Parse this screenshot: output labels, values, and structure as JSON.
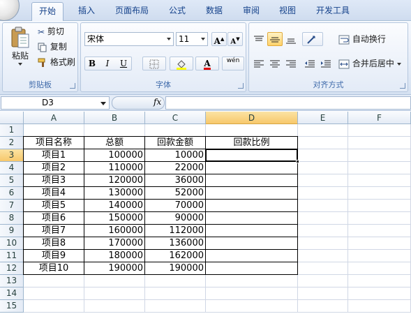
{
  "tabs": [
    "开始",
    "插入",
    "页面布局",
    "公式",
    "数据",
    "审阅",
    "视图",
    "开发工具"
  ],
  "clipboard": {
    "paste": "粘贴",
    "cut": "剪切",
    "copy": "复制",
    "format_painter": "格式刷",
    "label": "剪贴板"
  },
  "font": {
    "name": "宋体",
    "size": "11",
    "label": "字体",
    "bold": "B",
    "italic": "I",
    "underline": "U",
    "grow": "A",
    "shrink": "A",
    "font_color": "A",
    "phonetic": "wén"
  },
  "alignment": {
    "wrap": "自动换行",
    "merge": "合并后居中",
    "label": "对齐方式"
  },
  "formula_bar": {
    "name_box": "D3",
    "fx": "fx",
    "value": ""
  },
  "columns": [
    "A",
    "B",
    "C",
    "D",
    "E",
    "F"
  ],
  "rows": [
    "1",
    "2",
    "3",
    "4",
    "5",
    "6",
    "7",
    "8",
    "9",
    "10",
    "11",
    "12",
    "13",
    "14",
    "15"
  ],
  "table": {
    "headers": [
      "项目名称",
      "总额",
      "回款金额",
      "回款比例"
    ],
    "rows": [
      [
        "项目1",
        "100000",
        "10000",
        ""
      ],
      [
        "项目2",
        "110000",
        "22000",
        ""
      ],
      [
        "项目3",
        "120000",
        "36000",
        ""
      ],
      [
        "项目4",
        "130000",
        "52000",
        ""
      ],
      [
        "项目5",
        "140000",
        "70000",
        ""
      ],
      [
        "项目6",
        "150000",
        "90000",
        ""
      ],
      [
        "项目7",
        "160000",
        "112000",
        ""
      ],
      [
        "项目8",
        "170000",
        "136000",
        ""
      ],
      [
        "项目9",
        "180000",
        "162000",
        ""
      ],
      [
        "项目10",
        "190000",
        "190000",
        ""
      ]
    ]
  },
  "selected_cell": "D3",
  "colors": {
    "ribbon_text": "#15428b",
    "selection_header": "#f7c86b",
    "font_color_bar": "#e00000",
    "fill_color_bar": "#ffff00"
  }
}
